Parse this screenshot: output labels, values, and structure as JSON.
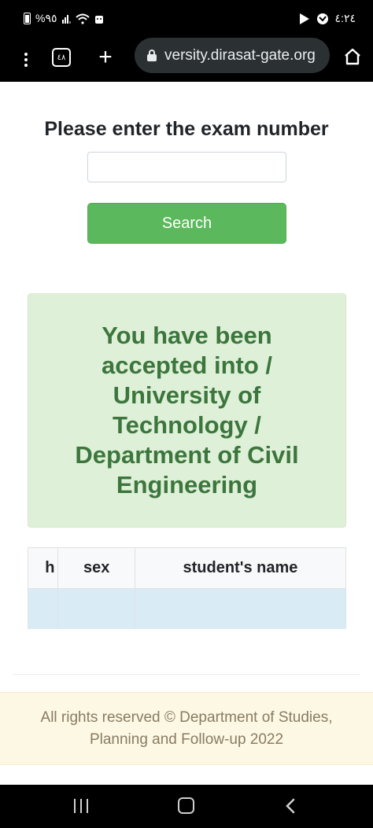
{
  "status_bar": {
    "battery": "%٩٥",
    "time": "٤:٢٤"
  },
  "browser": {
    "tab_count": "٤٨",
    "url": "versity.dirasat-gate.org"
  },
  "page": {
    "heading": "Please enter the exam number",
    "exam_input": {
      "value": "",
      "placeholder": ""
    },
    "search_label": "Search",
    "result_message": "You have been accepted into / University of Technology / Department of Civil Engineering",
    "table": {
      "headers": [
        "h",
        "sex",
        "student's name"
      ],
      "rows": [
        [
          "",
          "",
          ""
        ]
      ]
    },
    "footer": "All rights reserved © Department of Studies, Planning and Follow-up 2022"
  },
  "colors": {
    "search_button": "#5cb85c",
    "alert_background": "#dff0d8",
    "alert_text": "#3c763d",
    "table_row": "#d9ecf5",
    "footer_background": "#fcf8e3"
  }
}
